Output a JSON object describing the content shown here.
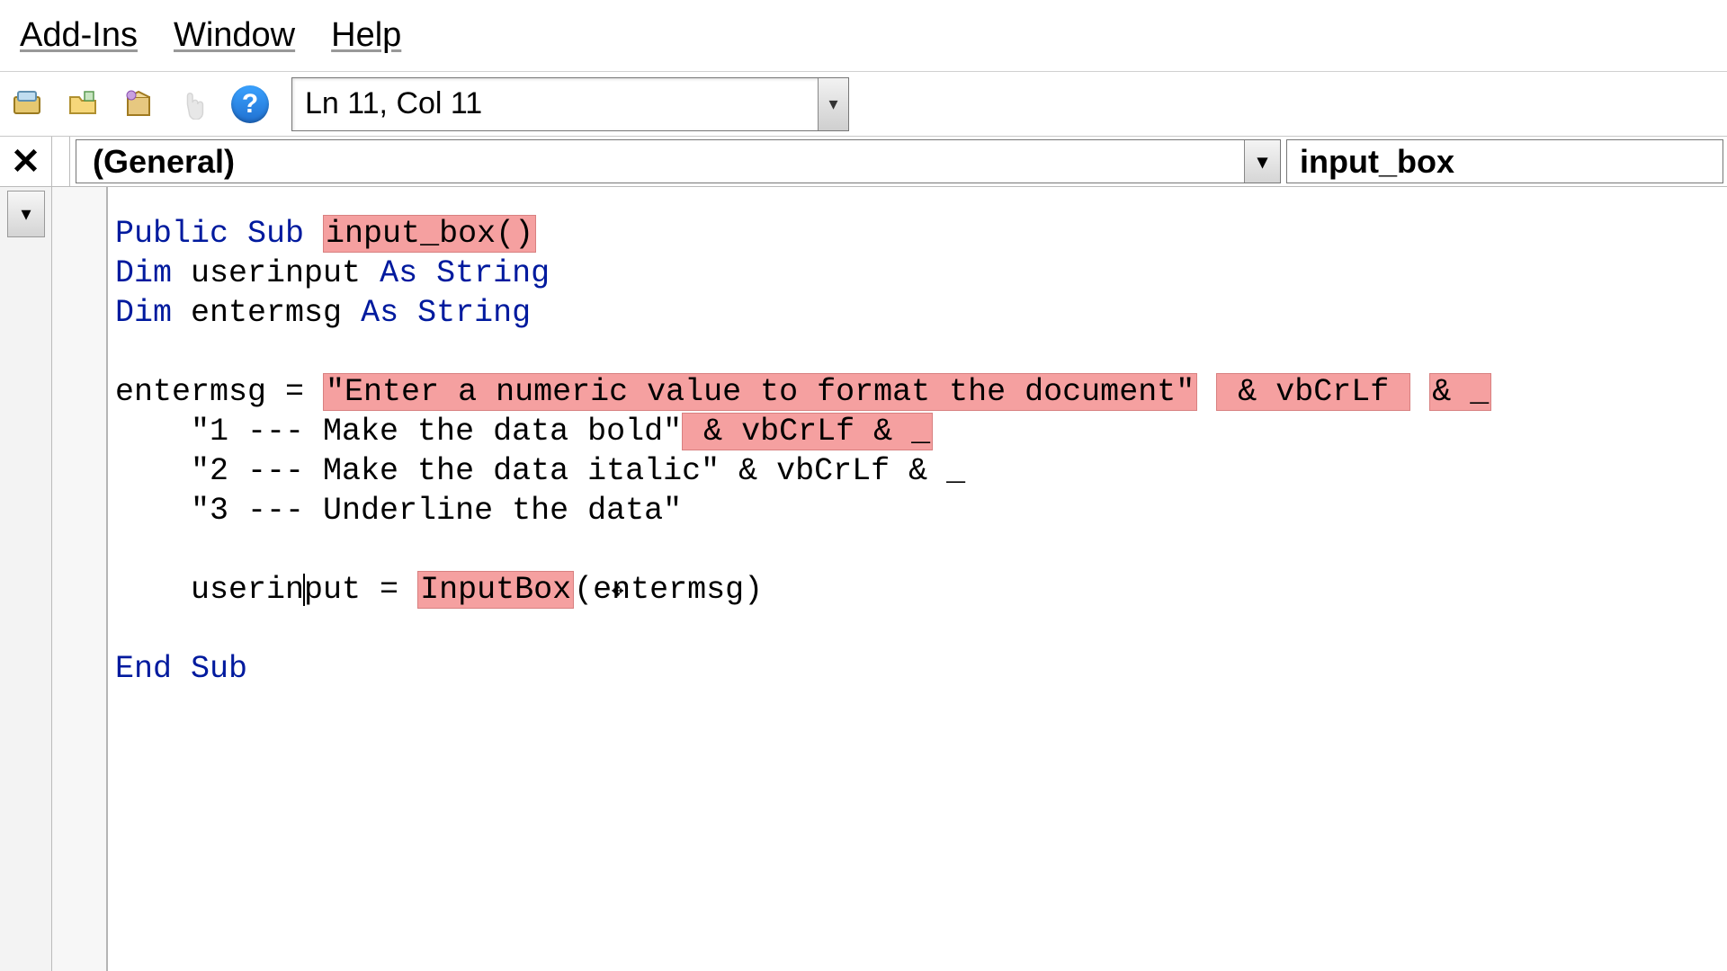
{
  "menubar": {
    "addins": "Add-Ins",
    "window": "Window",
    "help": "Help"
  },
  "toolbar": {
    "position_text": "Ln 11, Col 11"
  },
  "dropdowns": {
    "object_selected": "(General)",
    "procedure_selected": "input_box"
  },
  "code": {
    "kw_public_sub": "Public Sub ",
    "sub_name": "input_box()",
    "dim1_a": "Dim",
    "dim1_b": " userinput ",
    "dim1_c": "As String",
    "dim2_a": "Dim",
    "dim2_b": " entermsg ",
    "dim2_c": "As String",
    "assign_lhs": "entermsg = ",
    "str_main": "\"Enter a numeric value to format the document\"",
    "amp1": " & vbCrLf ",
    "amp1b": "& _",
    "line2_pad": "    ",
    "str_opt1": "\"1 --- Make the data bold\"",
    "amp2": " & vbCrLf & _",
    "line3_pad": "    ",
    "str_opt2": "\"2 --- Make the data italic\"",
    "amp3": " & vbCrLf & _",
    "line4_pad": "    ",
    "str_opt3": "\"3 --- Underline the data\"",
    "userinput_pad": "    ",
    "userinput_lhs_a": "userin",
    "userinput_lhs_b": "put = ",
    "inputbox_fn": "InputBox",
    "inputbox_arg": "(entermsg)",
    "end_sub": "End Sub"
  },
  "icons": {
    "close": "✕",
    "chev_down": "▾",
    "help": "?"
  }
}
